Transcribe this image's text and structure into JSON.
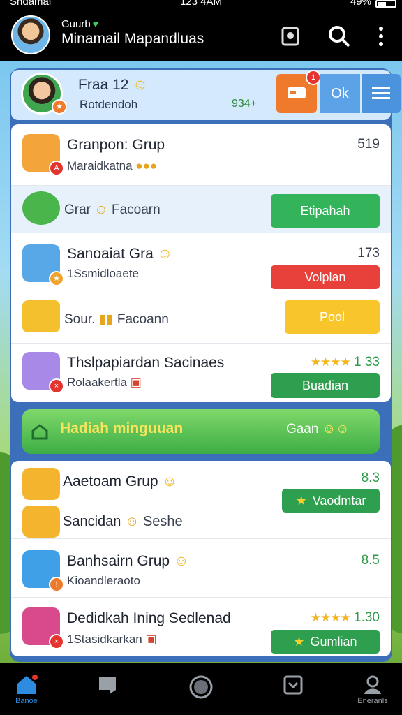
{
  "status_bar": {
    "carrier": "Sndamal",
    "time": "123 4AM",
    "battery": "49%"
  },
  "app_bar": {
    "subtitle": "Guurb",
    "title": "Minamail Mapandluas"
  },
  "profile": {
    "name": "Fraa 12",
    "subtitle": "Rotdendoh",
    "score": "934+",
    "notification_count": "1",
    "ok_label": "Ok"
  },
  "groups_top": [
    {
      "title": "Granpon: Grup",
      "subtitle": "Maraidkatna",
      "value": "519"
    },
    {
      "title": "Grar",
      "subtitle": "Facoarn",
      "action": "Etipahah"
    },
    {
      "title": "Sanoaiat Gra",
      "subtitle": "1Ssmidloaete",
      "value": "173",
      "action": "Volplan"
    },
    {
      "title": "Sour.",
      "subtitle": "Facoann",
      "action": "Pool"
    },
    {
      "title": "Thslpapiardan Sacinaes",
      "subtitle": "Rolaakertla",
      "value": "1 33",
      "rating": 4,
      "action": "Buadian"
    }
  ],
  "weekly_banner": {
    "title": "Hadiah minguuan",
    "right_label": "Gaan"
  },
  "groups_bottom": [
    {
      "title": "Aaetoam Grup",
      "value": "8.3",
      "action": "Vaodmtar"
    },
    {
      "title": "Sancidan",
      "subtitle": "Seshe"
    },
    {
      "title": "Banhsairn Grup",
      "subtitle": "Kioandleraoto",
      "value": "8.5"
    },
    {
      "title": "Dedidkah Ining Sedlenad",
      "subtitle": "1Stasidkarkan",
      "value": "1.30",
      "rating": 4,
      "action": "Gumlian"
    }
  ],
  "bottom_nav": [
    "Banoe",
    "",
    "",
    "",
    "Eneranls"
  ],
  "colors": {
    "accent_green": "#33b35a",
    "accent_red": "#e8403a",
    "accent_yellow": "#f8c62a",
    "brand_blue": "#3b6fb9"
  },
  "icons": {
    "search": "search-icon",
    "more": "more-vertical-icon",
    "save": "bookmark-icon",
    "menu": "menu-icon"
  }
}
